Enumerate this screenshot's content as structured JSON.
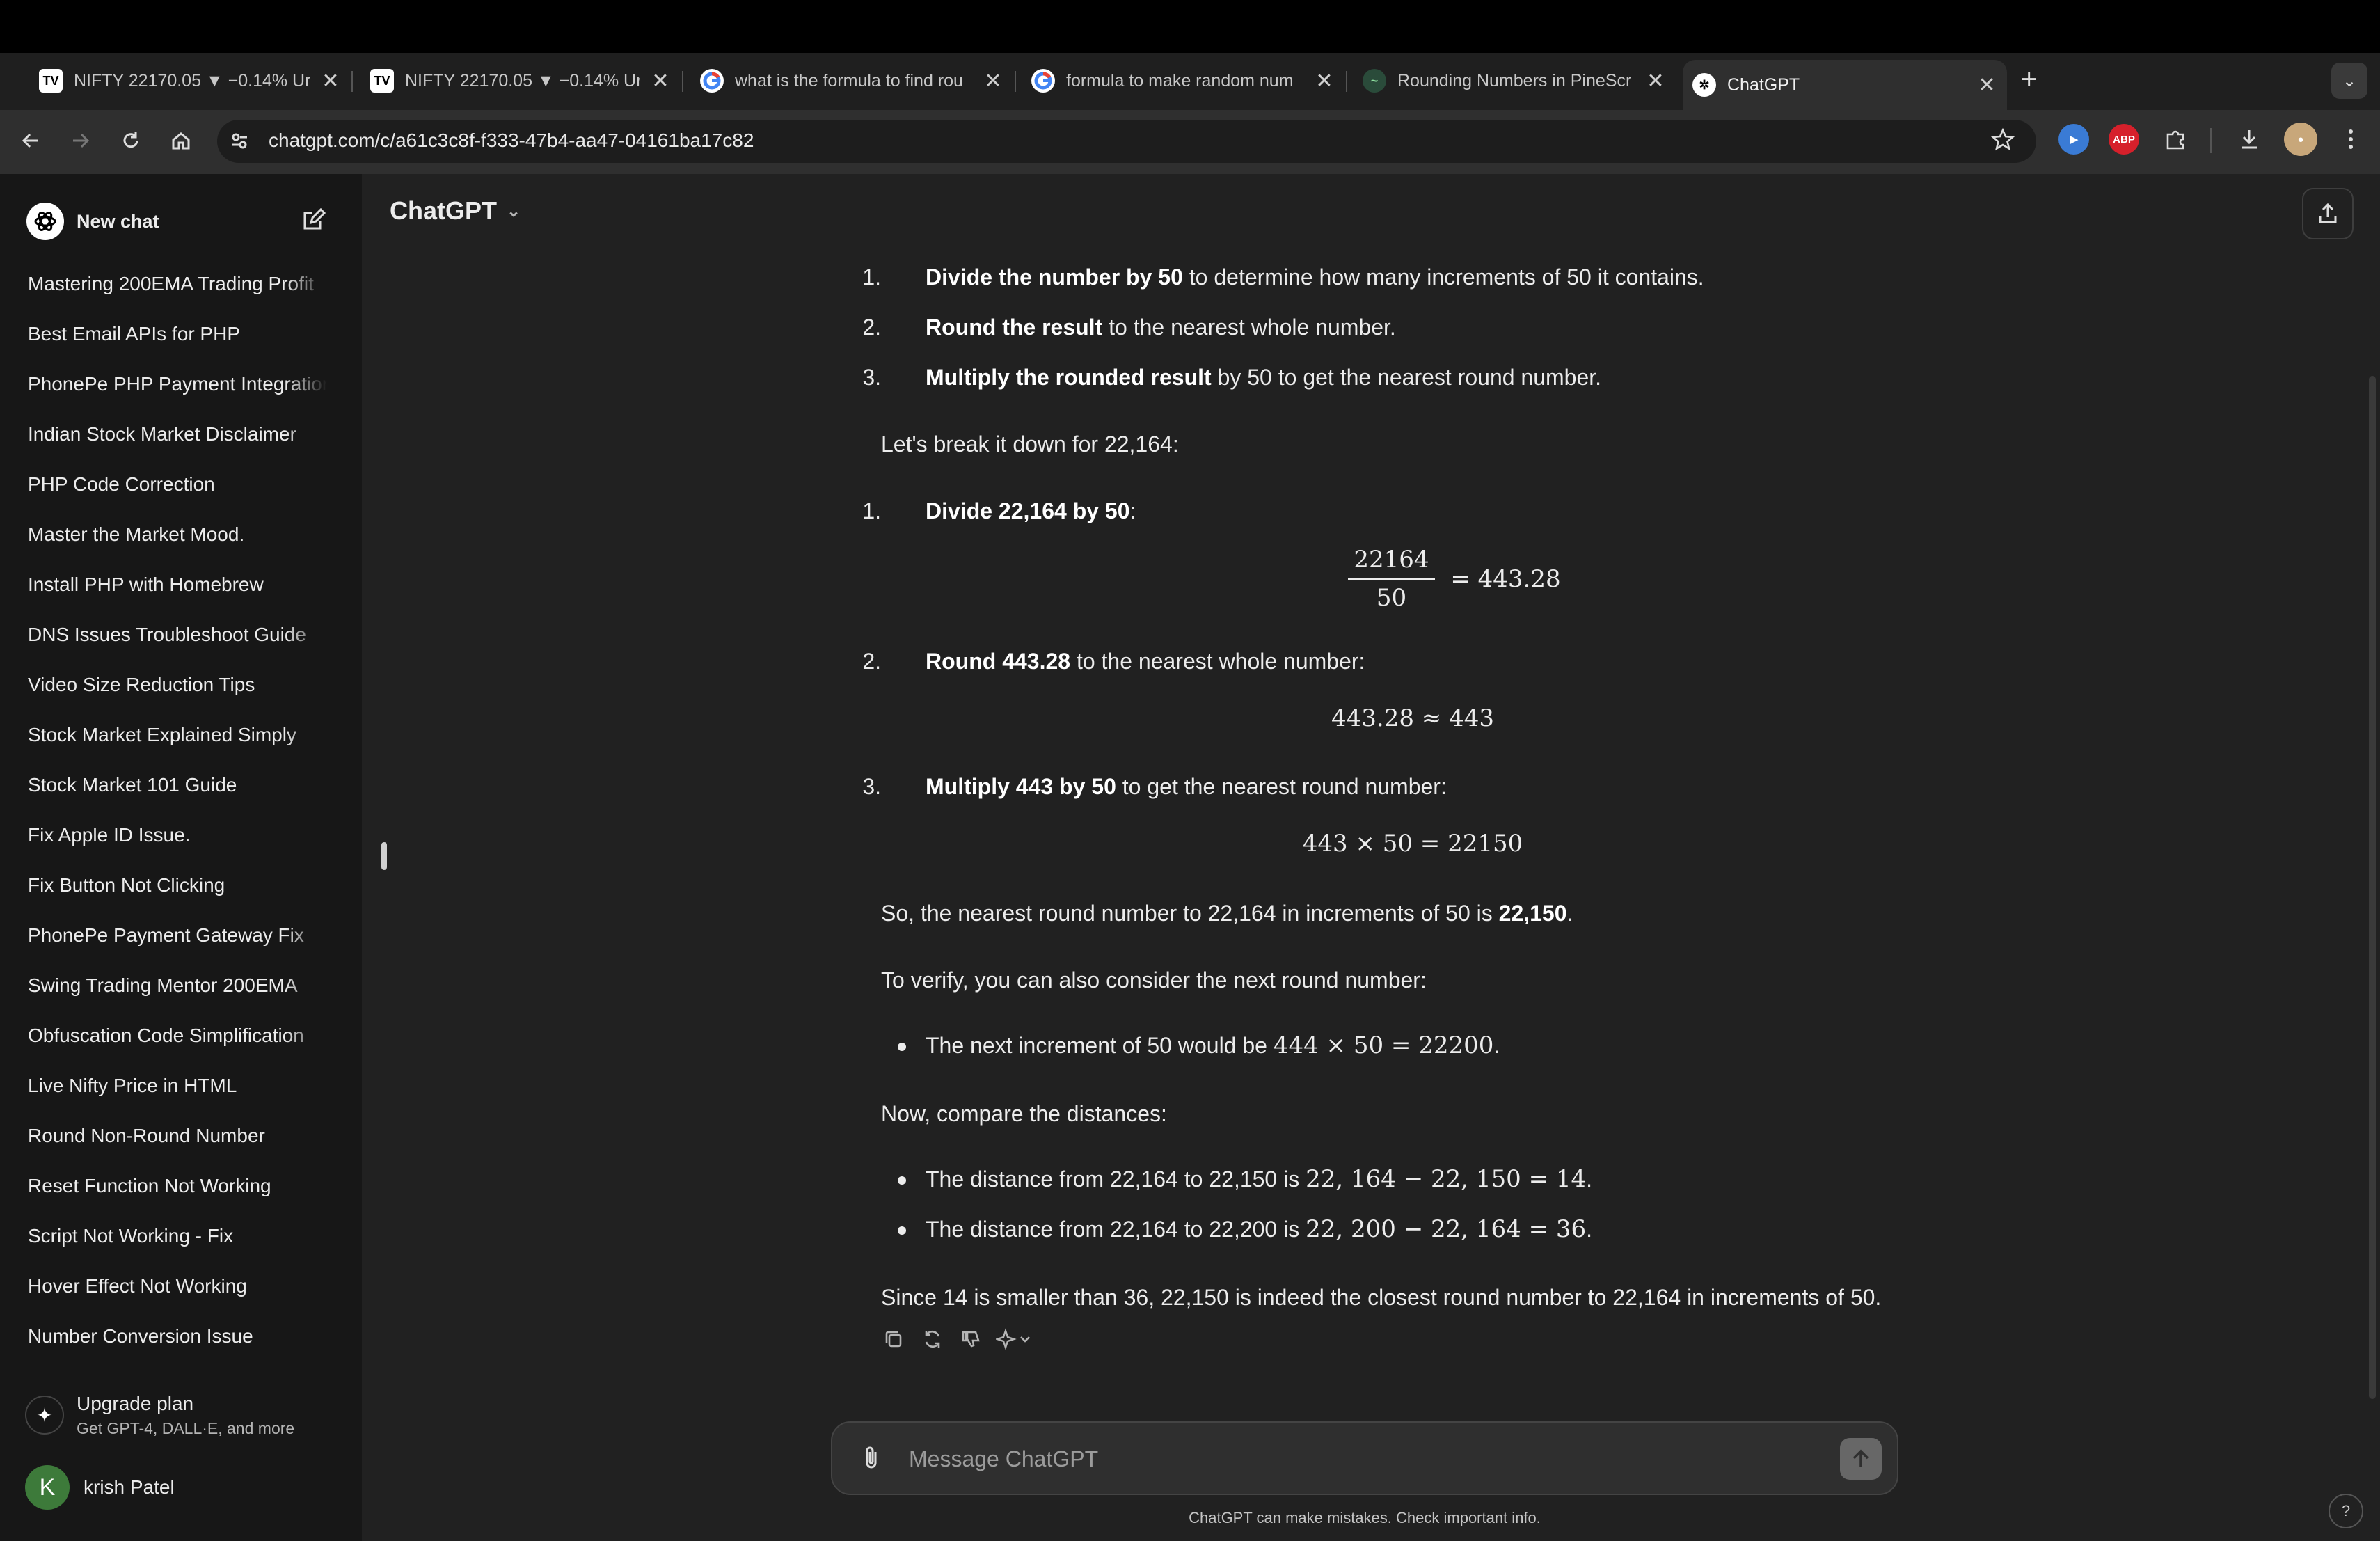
{
  "browser": {
    "tabs": [
      {
        "title": "NIFTY 22170.05 ▼ −0.14% Ur",
        "favicon": "tradingview-icon",
        "active": false
      },
      {
        "title": "NIFTY 22170.05 ▼ −0.14% Ur",
        "favicon": "tradingview-icon",
        "active": false
      },
      {
        "title": "what is the formula to find rou",
        "favicon": "google-icon",
        "active": false
      },
      {
        "title": "formula to make random num",
        "favicon": "google-icon",
        "active": false
      },
      {
        "title": "Rounding Numbers in PineScr",
        "favicon": "pinescript-icon",
        "active": false
      },
      {
        "title": "ChatGPT",
        "favicon": "chatgpt-icon",
        "active": true
      }
    ],
    "url": "chatgpt.com/c/a61c3c8f-f333-47b4-aa47-04161ba17c82",
    "extensions": [
      {
        "label": "ABP"
      }
    ]
  },
  "sidebar": {
    "new_chat": "New chat",
    "chats": [
      "Mastering 200EMA Trading Profit",
      "Best Email APIs for PHP",
      "PhonePe PHP Payment Integration",
      "Indian Stock Market Disclaimer",
      "PHP Code Correction",
      "Master the Market Mood.",
      "Install PHP with Homebrew",
      "DNS Issues Troubleshoot Guide",
      "Video Size Reduction Tips",
      "Stock Market Explained Simply",
      "Stock Market 101 Guide",
      "Fix Apple ID Issue.",
      "Fix Button Not Clicking",
      "PhonePe Payment Gateway Fix",
      "Swing Trading Mentor 200EMA",
      "Obfuscation Code Simplification",
      "Live Nifty Price in HTML",
      "Round Non-Round Number",
      "Reset Function Not Working",
      "Script Not Working - Fix",
      "Hover Effect Not Working",
      "Number Conversion Issue"
    ],
    "upgrade_title": "Upgrade plan",
    "upgrade_sub": "Get GPT-4, DALL·E, and more",
    "user_initial": "K",
    "user_name": "krish Patel"
  },
  "header": {
    "model": "ChatGPT"
  },
  "message": {
    "steps1": [
      {
        "n": "1.",
        "bold": "Divide the number by 50",
        "rest": " to determine how many increments of 50 it contains."
      },
      {
        "n": "2.",
        "bold": "Round the result",
        "rest": " to the nearest whole number."
      },
      {
        "n": "3.",
        "bold": "Multiply the rounded result",
        "rest": " by 50 to get the nearest round number."
      }
    ],
    "breakdown": "Let's break it down for 22,164:",
    "step_a": {
      "n": "1.",
      "bold": "Divide 22,164 by 50",
      "rest": ":"
    },
    "eq_a": {
      "numerator": "22164",
      "denominator": "50",
      "result": "= 443.28"
    },
    "step_b": {
      "n": "2.",
      "bold": "Round 443.28",
      "rest": " to the nearest whole number:"
    },
    "eq_b": "443.28 ≈ 443",
    "step_c": {
      "n": "3.",
      "bold": "Multiply 443 by 50",
      "rest": " to get the nearest round number:"
    },
    "eq_c": "443 × 50 = 22150",
    "so_prefix": "So, the nearest round number to 22,164 in increments of 50 is ",
    "so_bold": "22,150",
    "so_suffix": ".",
    "verify": "To verify, you can also consider the next round number:",
    "bullet1_text": "The next increment of 50 would be ",
    "bullet1_math": "444 × 50 = 22200",
    "bullet1_end": ".",
    "compare": "Now, compare the distances:",
    "bullet2_text": "The distance from 22,164 to 22,150 is ",
    "bullet2_math": "22, 164 − 22, 150 = 14",
    "bullet2_end": ".",
    "bullet3_text": "The distance from 22,164 to 22,200 is ",
    "bullet3_math": "22, 200 − 22, 164 = 36",
    "bullet3_end": ".",
    "conclusion": "Since 14 is smaller than 36, 22,150 is indeed the closest round number to 22,164 in increments of 50."
  },
  "composer": {
    "placeholder": "Message ChatGPT",
    "disclaimer": "ChatGPT can make mistakes. Check important info.",
    "help": "?"
  }
}
